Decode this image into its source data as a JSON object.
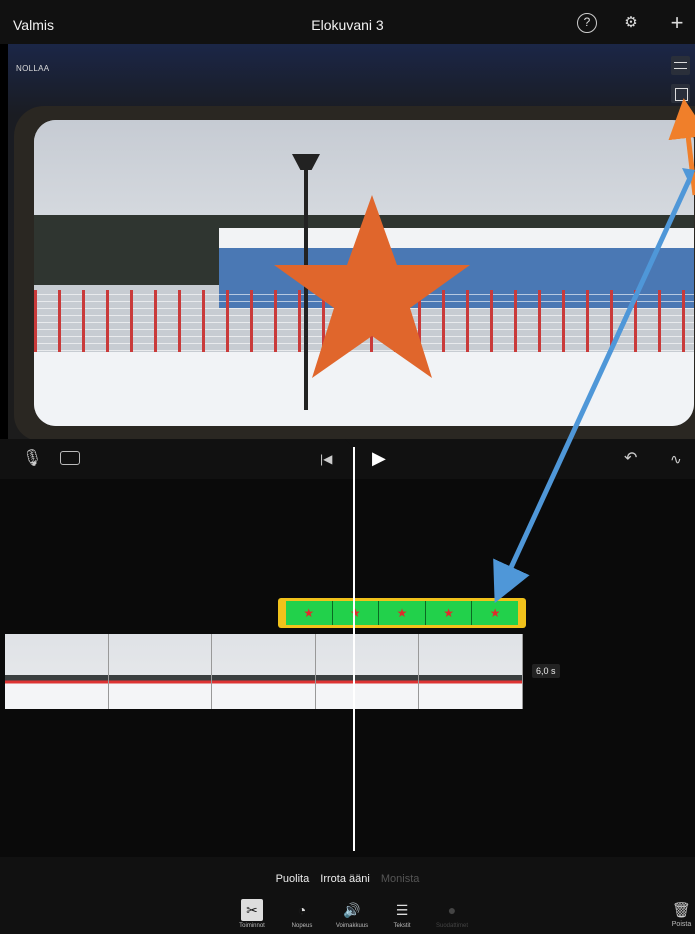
{
  "topbar": {
    "done_label": "Valmis",
    "title": "Elokuvani 3"
  },
  "viewer": {
    "reset_label": "NOLLAA"
  },
  "timeline": {
    "duration_label": "6,0 s"
  },
  "actions": {
    "split": "Puolita",
    "detach_audio": "Irrota ääni",
    "duplicate": "Monista"
  },
  "tools": {
    "trim": "Toiminnot",
    "speed": "Nopeus",
    "volume": "Voimakkuus",
    "titles": "Tekstit",
    "filters": "Suodattimet"
  },
  "delete_label": "Poista",
  "colors": {
    "overlay_border": "#f1c21b",
    "overlay_fill": "#22d14b",
    "star": "#e0662c",
    "arrow_orange": "#f07f2a",
    "arrow_blue": "#4f97d8"
  },
  "icons": [
    "help-icon",
    "gear-icon",
    "plus-icon",
    "adjust-icon",
    "crop-icon",
    "mic-icon",
    "camera-icon",
    "skip-back-icon",
    "play-icon",
    "undo-icon",
    "waveform-icon",
    "scissors-icon",
    "speedometer-icon",
    "speaker-icon",
    "text-icon",
    "filter-icon",
    "trash-icon"
  ]
}
